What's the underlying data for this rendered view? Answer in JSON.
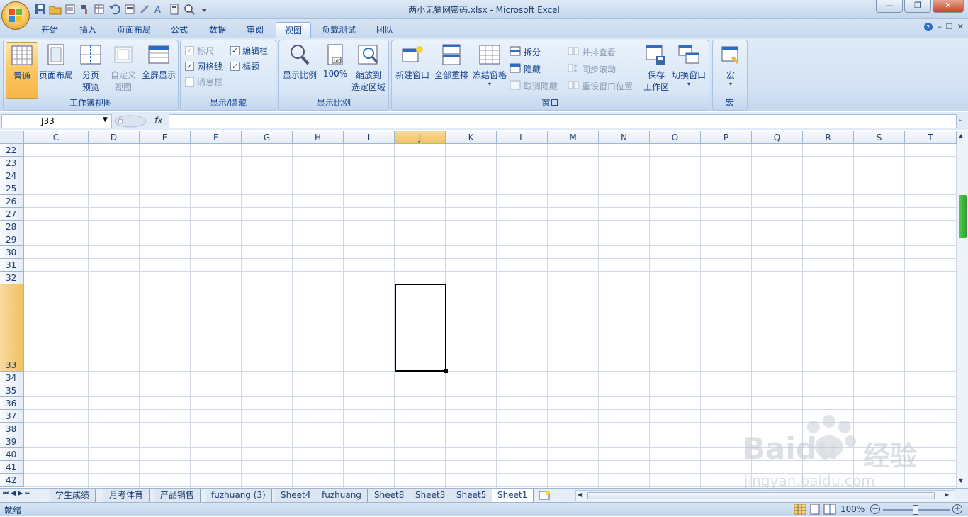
{
  "window": {
    "title": "两小无猜网密码.xlsx - Microsoft Excel"
  },
  "tabs": [
    {
      "label": "开始"
    },
    {
      "label": "插入"
    },
    {
      "label": "页面布局"
    },
    {
      "label": "公式"
    },
    {
      "label": "数据"
    },
    {
      "label": "审阅"
    },
    {
      "label": "视图"
    },
    {
      "label": "负载测试"
    },
    {
      "label": "团队"
    }
  ],
  "active_tab": "视图",
  "ribbon": {
    "workbook_views": {
      "label": "工作簿视图",
      "normal": "普通",
      "page_layout": "页面布局",
      "page_break_1": "分页",
      "page_break_2": "预览",
      "custom_1": "自定义",
      "custom_2": "视图",
      "fullscreen": "全屏显示"
    },
    "show_hide": {
      "label": "显示/隐藏",
      "ruler": "标尺",
      "gridlines": "网格线",
      "message_bar": "消息栏",
      "formula_bar": "编辑栏",
      "headings": "标题"
    },
    "zoom": {
      "label": "显示比例",
      "zoom": "显示比例",
      "hundred": "100%",
      "zoom_sel_1": "缩放到",
      "zoom_sel_2": "选定区域"
    },
    "window": {
      "label": "窗口",
      "new_window": "新建窗口",
      "arrange_all": "全部重排",
      "freeze": "冻结窗格",
      "split": "拆分",
      "hide": "隐藏",
      "unhide": "取消隐藏",
      "side_by_side": "并排查看",
      "sync_scroll": "同步滚动",
      "reset_pos": "重设窗口位置",
      "save_ws_1": "保存",
      "save_ws_2": "工作区",
      "switch": "切换窗口"
    },
    "macros": {
      "label": "宏",
      "macros": "宏"
    }
  },
  "formula_bar": {
    "name_box": "J33",
    "fx": "fx",
    "formula": ""
  },
  "columns": [
    "C",
    "D",
    "E",
    "F",
    "G",
    "H",
    "I",
    "J",
    "K",
    "L",
    "M",
    "N",
    "O",
    "P",
    "Q",
    "R",
    "S",
    "T"
  ],
  "rows": [
    "22",
    "23",
    "24",
    "25",
    "26",
    "27",
    "28",
    "29",
    "30",
    "31",
    "32",
    "33",
    "34",
    "35",
    "36",
    "37",
    "38",
    "39",
    "40",
    "41",
    "42"
  ],
  "selected_cell": "J33",
  "sheets": [
    {
      "name": "学生成绩"
    },
    {
      "name": "月考体育"
    },
    {
      "name": "产品销售"
    },
    {
      "name": "fuzhuang (3)"
    },
    {
      "name": "Sheet4"
    },
    {
      "name": "fuzhuang"
    },
    {
      "name": "Sheet8"
    },
    {
      "name": "Sheet3"
    },
    {
      "name": "Sheet5"
    },
    {
      "name": "Sheet1"
    }
  ],
  "active_sheet": "Sheet1",
  "status": {
    "ready": "就绪",
    "zoom": "100%"
  },
  "watermark": {
    "text1": "Baidu",
    "text2": "经验",
    "text3": "jingyan.baidu.com"
  },
  "colors": {
    "accent": "#f7b74a",
    "ribbon": "#d3e2f4",
    "grid": "#d0d7e5"
  }
}
